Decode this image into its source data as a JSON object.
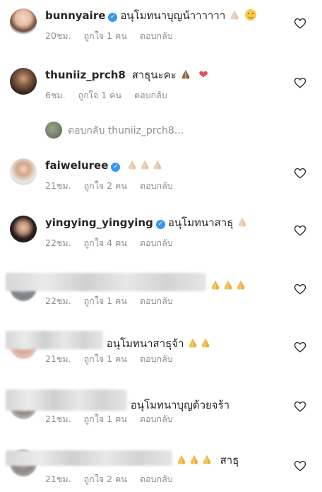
{
  "comments": [
    {
      "username": "bunnyaire",
      "verified": true,
      "text": "อนุโมทนาบุญน้าาาาาา",
      "time": "20ชม.",
      "likes": "ถูกใจ 1 คน",
      "reply": "ตอบกลับ"
    },
    {
      "username": "thuniiz_prch8",
      "verified": false,
      "text": "สาธุนะคะ",
      "time": "6ชม.",
      "likes": "ถูกใจ 1 คน",
      "reply": "ตอบกลับ"
    },
    {
      "username": "faiweluree",
      "verified": true,
      "text": "",
      "time": "21ชม.",
      "likes": "ถูกใจ 2 คน",
      "reply": "ตอบกลับ"
    },
    {
      "username": "yingying_yingying",
      "verified": true,
      "text": "อนุโมทนาสาธุ",
      "time": "22ชม.",
      "likes": "ถูกใจ 4 คน",
      "reply": "ตอบกลับ"
    },
    {
      "username": "",
      "verified": false,
      "text": "",
      "time": "22ชม.",
      "likes": "ถูกใจ 1 คน",
      "reply": "ตอบกลับ"
    },
    {
      "username": "",
      "verified": false,
      "text": "อนุโมทนาสาธุจ้า",
      "time": "21ชม.",
      "likes": "ถูกใจ 1 คน",
      "reply": "ตอบกลับ"
    },
    {
      "username": "",
      "verified": false,
      "text": "อนุโมทนาบุญด้วยจร้า",
      "time": "21ชม.",
      "likes": "ถูกใจ 1 คน",
      "reply": "ตอบกลับ"
    },
    {
      "username": "",
      "verified": false,
      "text": "สาธุ",
      "time": "21ชม.",
      "likes": "ถูกใจ 2 คน",
      "reply": "ตอบกลับ"
    }
  ],
  "view_replies": "ตอบกลับ thuniiz_prch8...",
  "icons": {
    "like": "heart-outline-icon",
    "verified": "verified-badge-icon",
    "emoji_pray": "folded-hands-emoji",
    "emoji_smile": "smiling-face-emoji",
    "emoji_heart": "red-heart-emoji"
  },
  "colors": {
    "verified_blue": "#3897f0",
    "meta_gray": "#8e8e8e",
    "heart_red": "#ed4956"
  }
}
